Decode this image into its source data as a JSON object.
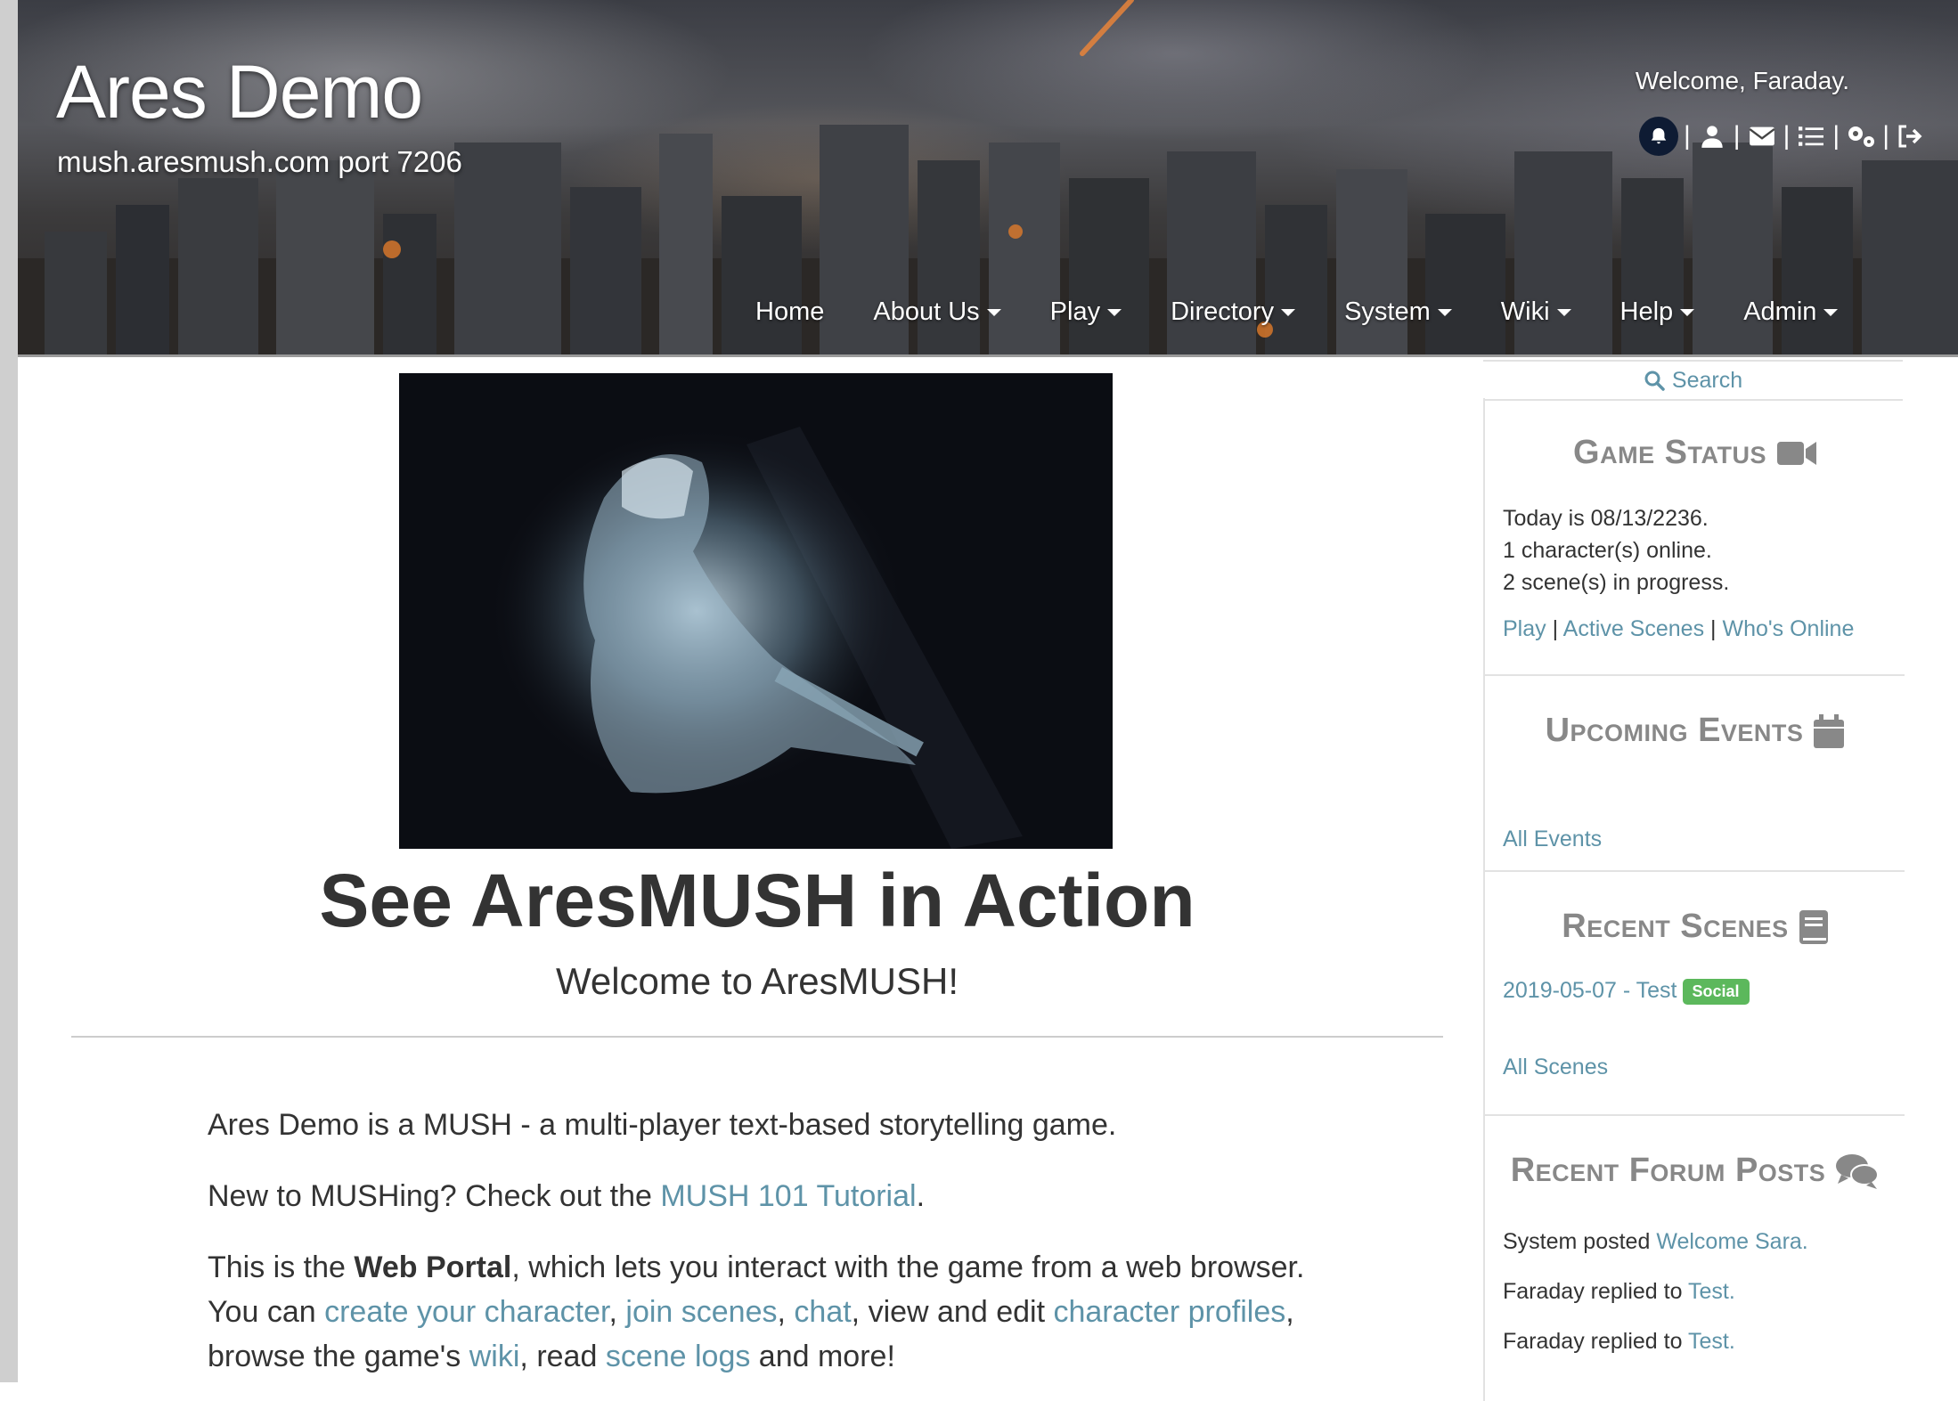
{
  "header": {
    "site_title": "Ares Demo",
    "site_subtitle": "mush.aresmush.com port 7206",
    "welcome": "Welcome, Faraday.",
    "icons": [
      "bell-icon",
      "user-icon",
      "mail-icon",
      "list-icon",
      "gears-icon",
      "logout-icon"
    ],
    "icon_separator": "|"
  },
  "nav": {
    "items": [
      {
        "label": "Home",
        "dropdown": false
      },
      {
        "label": "About Us",
        "dropdown": true
      },
      {
        "label": "Play",
        "dropdown": true
      },
      {
        "label": "Directory",
        "dropdown": true
      },
      {
        "label": "System",
        "dropdown": true
      },
      {
        "label": "Wiki",
        "dropdown": true
      },
      {
        "label": "Help",
        "dropdown": true
      },
      {
        "label": "Admin",
        "dropdown": true
      }
    ]
  },
  "main": {
    "title": "See AresMUSH in Action",
    "subtitle": "Welcome to AresMUSH!",
    "p1": "Ares Demo is a MUSH - a multi-player text-based storytelling game.",
    "p2_prefix": "New to MUSHing? Check out the ",
    "p2_link": "MUSH 101 Tutorial",
    "p2_suffix": ".",
    "p3_prefix": "This is the ",
    "p3_bold": "Web Portal",
    "p3_after_bold": ", which lets you interact with the game from a web browser.",
    "p3_line2_prefix": "You can ",
    "link_create": "create your character",
    "comma1": ", ",
    "link_join": "join scenes",
    "comma2": ", ",
    "link_chat": "chat",
    "text_view": ", view and edit ",
    "link_profiles": "character profiles",
    "comma3": ",",
    "text_browse": "browse the game's ",
    "link_wiki": "wiki",
    "text_read": ", read ",
    "link_logs": "scene logs",
    "text_more": " and more!"
  },
  "sidebar": {
    "search_label": "Search",
    "game_status": {
      "title": "Game Status",
      "line1": "Today is 08/13/2236.",
      "line2": "1 character(s) online.",
      "line3": "2 scene(s) in progress.",
      "link_play": "Play",
      "link_active": "Active Scenes",
      "link_online": "Who's Online",
      "sep": " | "
    },
    "upcoming_events": {
      "title": "Upcoming Events",
      "link_all": "All Events"
    },
    "recent_scenes": {
      "title": "Recent Scenes",
      "scene_link": "2019-05-07 - Test",
      "scene_badge": "Social",
      "link_all": "All Scenes"
    },
    "recent_forum": {
      "title": "Recent Forum Posts",
      "post1_prefix": "System posted ",
      "post1_link": "Welcome Sara.",
      "post2_prefix": "Faraday replied to ",
      "post2_link": "Test.",
      "post3_prefix": "Faraday replied to ",
      "post3_link": "Test."
    }
  },
  "colors": {
    "link": "#5e93a8",
    "badge_social": "#5cb85c",
    "panel_title": "#888888",
    "text": "#333333"
  }
}
